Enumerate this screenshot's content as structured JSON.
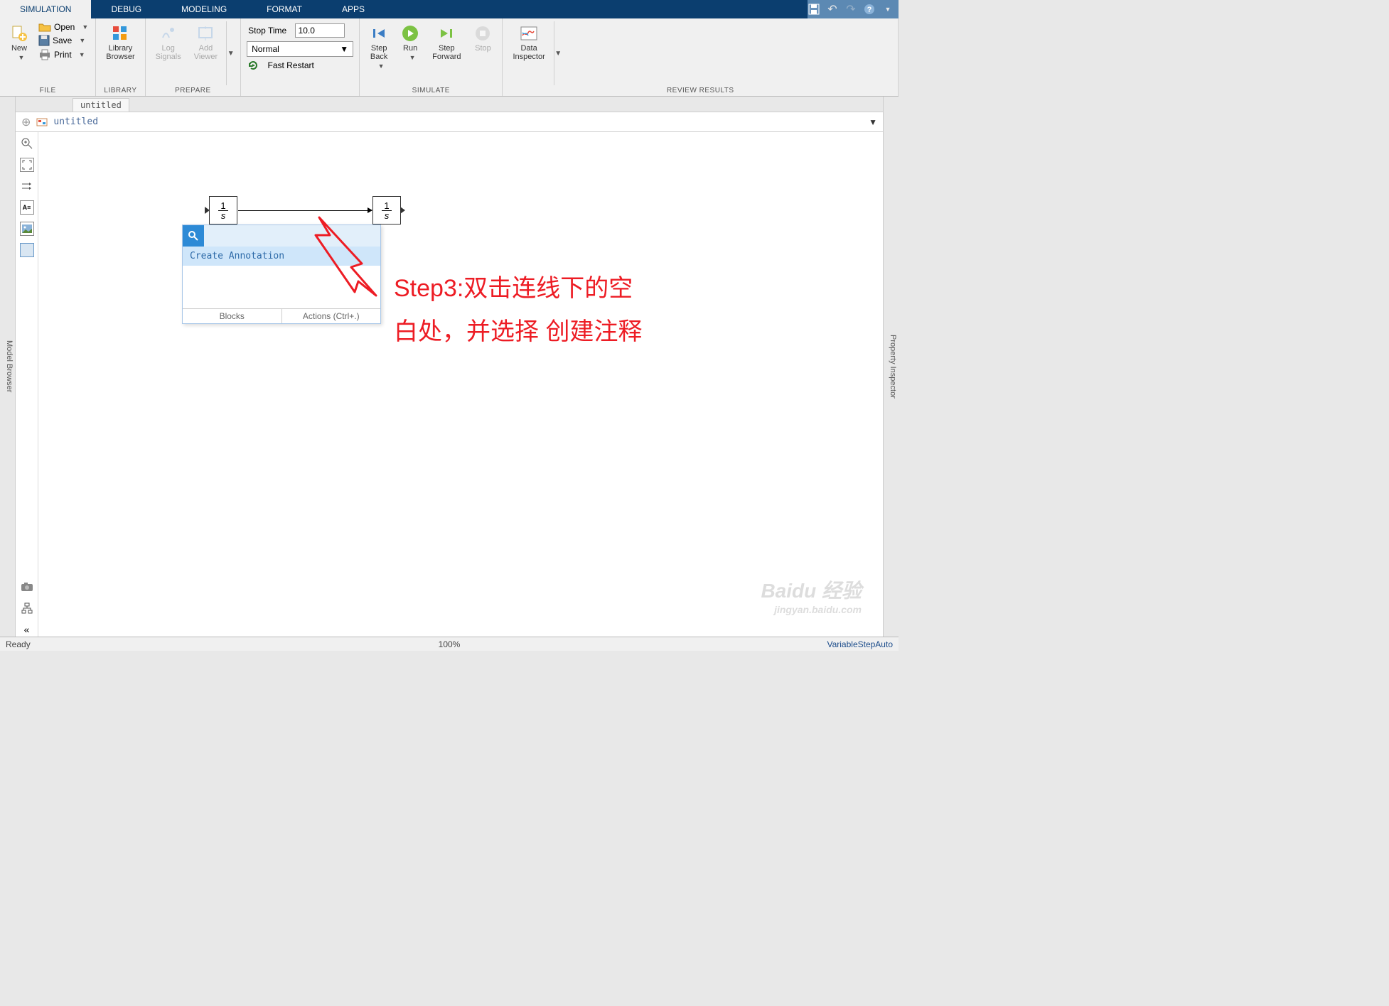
{
  "tabs": {
    "simulation": "SIMULATION",
    "debug": "DEBUG",
    "modeling": "MODELING",
    "format": "FORMAT",
    "apps": "APPS"
  },
  "file": {
    "new": "New",
    "open": "Open",
    "save": "Save",
    "print": "Print",
    "group": "FILE"
  },
  "library": {
    "browser": "Library\nBrowser",
    "group": "LIBRARY"
  },
  "prepare": {
    "log": "Log\nSignals",
    "viewer": "Add\nViewer",
    "stoptime_label": "Stop Time",
    "stoptime_value": "10.0",
    "mode": "Normal",
    "fast": "Fast Restart",
    "group": "PREPARE"
  },
  "simulate": {
    "back": "Step\nBack",
    "run": "Run",
    "forward": "Step\nForward",
    "stop": "Stop",
    "group": "SIMULATE"
  },
  "review": {
    "inspector": "Data\nInspector",
    "group": "REVIEW RESULTS"
  },
  "browser_strip": "Model Browser",
  "inspector_strip": "Property Inspector",
  "doc_tab": "untitled",
  "crumb": "untitled",
  "popup": {
    "create": "Create Annotation",
    "blocks": "Blocks",
    "actions": "Actions (Ctrl+.)"
  },
  "anno": {
    "line1": "Step3:双击连线下的空",
    "line2": "白处，并选择 创建注释"
  },
  "status": {
    "ready": "Ready",
    "zoom": "100%",
    "solver": "VariableStepAuto"
  },
  "watermark": {
    "main": "Baidu 经验",
    "sub": "jingyan.baidu.com"
  },
  "block_label": "1/s"
}
